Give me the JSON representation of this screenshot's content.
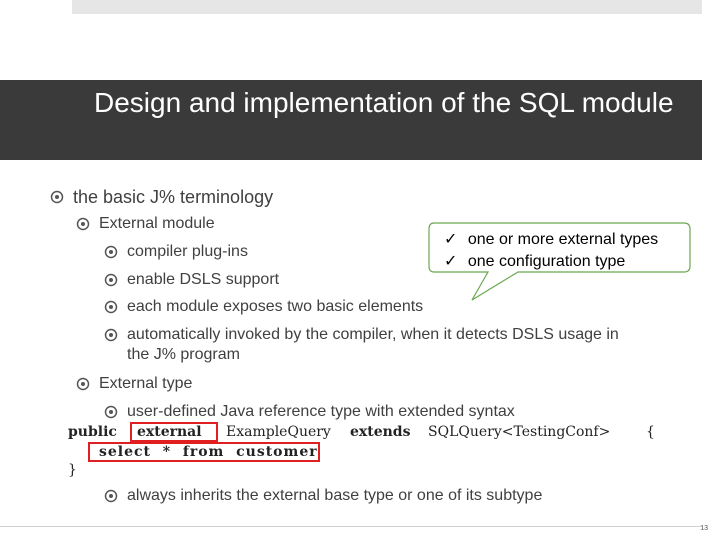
{
  "slide": {
    "title": "Design and implementation of the SQL module",
    "page_number": "13"
  },
  "bullets": {
    "l1_terminology": "the basic J% terminology",
    "l2_external_module": "External module",
    "l3_compiler_plugins": "compiler plug-ins",
    "l3_enable_dsls": "enable DSLS support",
    "l3_each_module": "each module exposes two basic elements",
    "l3_auto_invoked_1": "automatically invoked by the compiler, when it detects DSLS usage in",
    "l3_auto_invoked_2": "the J% program",
    "l2_external_type": "External type",
    "l3_user_defined": "user-defined Java reference type with extended syntax",
    "l3_always_inherits": "always inherits the external base type or one of its subtype"
  },
  "callout": {
    "item1": "one or more external types",
    "item2": "one configuration type",
    "check_glyph": "✓"
  },
  "code": {
    "public": "public",
    "external": "external",
    "example_query": "ExampleQuery",
    "extends": "extends",
    "sqlquery": "SQLQuery<TestingConf>",
    "open_brace": "{",
    "select_from": "select  *  from  customer",
    "close_brace": "}"
  },
  "colors": {
    "title_band": "#3a3a3a",
    "highlight_box": "#e02020",
    "callout_border": "#6aa84f"
  },
  "icons": [
    "target-bullet-icon",
    "check-icon"
  ]
}
